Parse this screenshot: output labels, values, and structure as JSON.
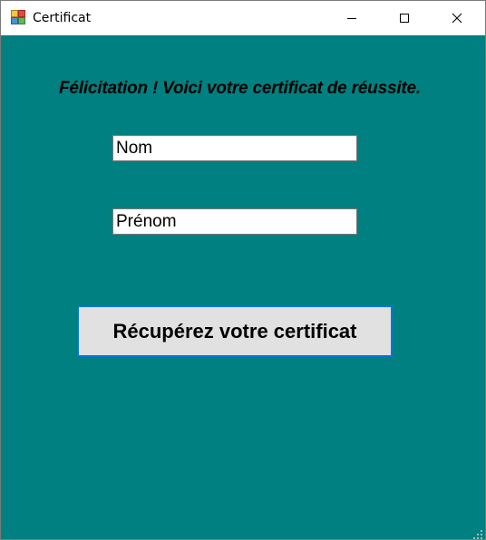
{
  "window": {
    "title": "Certificat",
    "icon": "winforms-app-icon",
    "controls": {
      "minimize": "minimize-icon",
      "maximize": "maximize-icon",
      "close": "close-icon"
    }
  },
  "form": {
    "heading": "Félicitation ! Voici votre certificat de réussite.",
    "nom_value": "Nom",
    "prenom_value": "Prénom",
    "submit_label": "Récupérez votre certificat"
  },
  "colors": {
    "background": "#008080",
    "button_face": "#e1e1e1",
    "button_focus_border": "#0078d7"
  }
}
